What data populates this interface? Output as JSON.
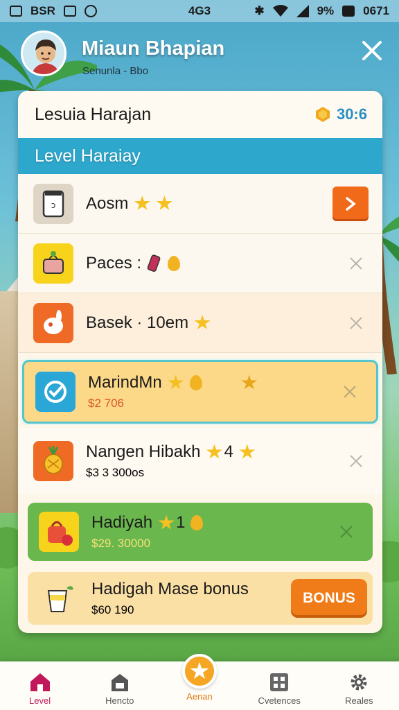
{
  "status_bar": {
    "left_text": "BSR",
    "center_text": "4G3",
    "battery_text": "9%",
    "time": "0671"
  },
  "header": {
    "title": "Miaun Bhapian",
    "subtitle": "Senunla - Bbo"
  },
  "panel": {
    "title": "Lesuia Harajan",
    "coins": "30:6",
    "section_title": "Level Haraiay"
  },
  "rows": [
    {
      "name": "Aosm",
      "icon": "jar-icon"
    },
    {
      "name": "Paces :",
      "icon": "basket-icon"
    },
    {
      "name": "Basek · 10em",
      "icon": "bunny-icon"
    }
  ],
  "cards": {
    "highlight": {
      "name": "MarindMn",
      "price": "$2 706",
      "icon": "target-icon"
    },
    "plain": {
      "name": "Nangen Hibakh",
      "suffix": "4",
      "price": "$3 3 300os",
      "icon": "pineapple-icon"
    },
    "green": {
      "name": "Hadiyah",
      "suffix": "1",
      "price": "$29. 30000",
      "icon": "bag-icon"
    },
    "bonus": {
      "name": "Hadigah Mase bonus",
      "price": "$60 190",
      "button": "BONUS",
      "icon": "cup-icon"
    }
  },
  "nav": {
    "items": [
      {
        "label": "Level",
        "icon": "home-icon"
      },
      {
        "label": "Hencto",
        "icon": "shop-icon"
      },
      {
        "label": "Aenan",
        "icon": "star-icon"
      },
      {
        "label": "Cvetences",
        "icon": "grid-icon"
      },
      {
        "label": "Reales",
        "icon": "gear-icon"
      }
    ]
  },
  "colors": {
    "accent_orange": "#f06a1a",
    "band_blue": "#2da7cc",
    "coin_blue": "#2a8fc2",
    "active_nav": "#c0185a"
  }
}
